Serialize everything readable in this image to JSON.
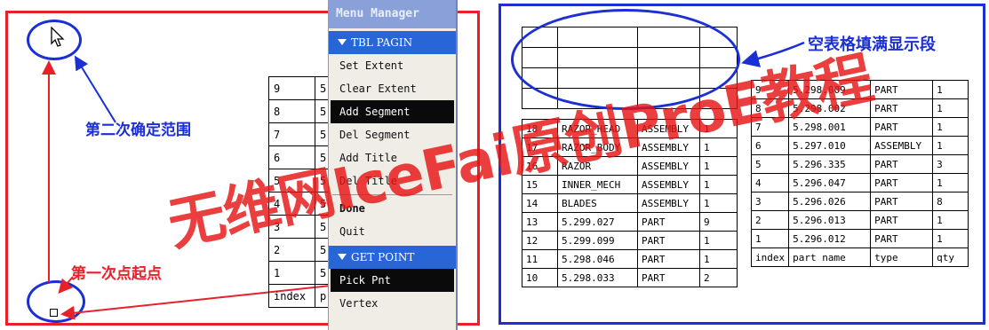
{
  "left": {
    "label_second": "第二次确定范围",
    "label_first": "第一次点起点",
    "table_rows": [
      [
        "9",
        "5"
      ],
      [
        "8",
        "5"
      ],
      [
        "7",
        "5"
      ],
      [
        "6",
        "5"
      ],
      [
        "5",
        "5"
      ],
      [
        "4",
        "5"
      ],
      [
        "3",
        "5"
      ],
      [
        "2",
        "5"
      ],
      [
        "1",
        "5"
      ],
      [
        "index",
        "p"
      ]
    ]
  },
  "menu": {
    "title": "Menu Manager",
    "group1": "TBL PAGIN",
    "items1": [
      "Set Extent",
      "Clear Extent",
      "Add Segment",
      "Del Segment",
      "Add Title",
      "Del Title"
    ],
    "items2": [
      "Done",
      "Quit"
    ],
    "group2": "GET POINT",
    "items3": [
      "Pick Pnt",
      "Vertex"
    ],
    "selected": [
      "Add Segment",
      "Pick Pnt"
    ]
  },
  "right": {
    "label": "空表格填满显示段",
    "left_table": [
      [
        "18",
        "RAZOR_HEAD",
        "ASSEMBLY",
        "1"
      ],
      [
        "17",
        "RAZOR_BODY",
        "ASSEMBLY",
        "1"
      ],
      [
        "16",
        "RAZOR",
        "ASSEMBLY",
        "1"
      ],
      [
        "15",
        "INNER_MECH",
        "ASSEMBLY",
        "1"
      ],
      [
        "14",
        "BLADES",
        "ASSEMBLY",
        "1"
      ],
      [
        "13",
        "5.299.027",
        "PART",
        "9"
      ],
      [
        "12",
        "5.299.099",
        "PART",
        "1"
      ],
      [
        "11",
        "5.298.046",
        "PART",
        "1"
      ],
      [
        "10",
        "5.298.033",
        "PART",
        "2"
      ]
    ],
    "right_table": [
      [
        "9",
        "5.298.009",
        "PART",
        "1"
      ],
      [
        "8",
        "5.298.002",
        "PART",
        "1"
      ],
      [
        "7",
        "5.298.001",
        "PART",
        "1"
      ],
      [
        "6",
        "5.297.010",
        "ASSEMBLY",
        "1"
      ],
      [
        "5",
        "5.296.335",
        "PART",
        "3"
      ],
      [
        "4",
        "5.296.047",
        "PART",
        "1"
      ],
      [
        "3",
        "5.296.026",
        "PART",
        "8"
      ],
      [
        "2",
        "5.296.013",
        "PART",
        "1"
      ],
      [
        "1",
        "5.296.012",
        "PART",
        "1"
      ],
      [
        "index",
        "part name",
        "type",
        "qty"
      ]
    ]
  },
  "watermark": "无维网IceFai原创ProE教程",
  "colors": {
    "red": "#e8202a",
    "blue": "#1a2fd6",
    "menu_blue": "#2866d8",
    "watermark": "#e61414"
  }
}
